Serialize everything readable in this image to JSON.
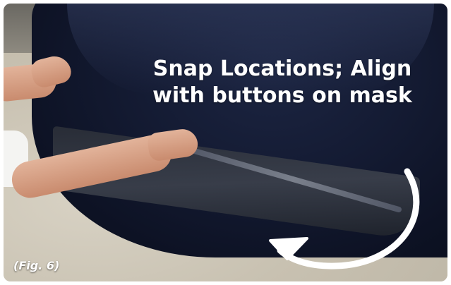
{
  "caption": {
    "line1": "Snap Locations; Align",
    "line2": "with buttons on mask"
  },
  "figure_label": "(Fig. 6)",
  "arrow_icon": "curved-arrow-icon",
  "colors": {
    "mask": "#141b33",
    "text": "#ffffff",
    "arrow": "#ffffff"
  }
}
